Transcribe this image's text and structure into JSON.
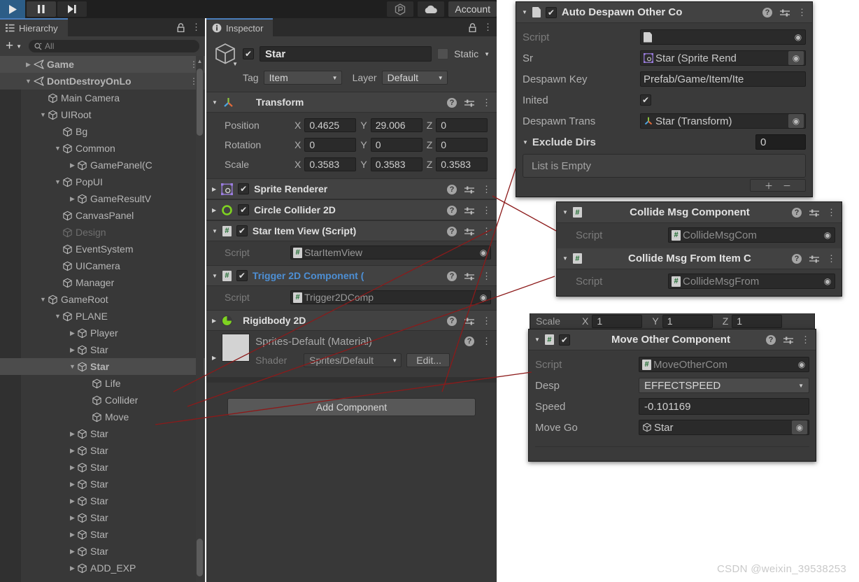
{
  "toolbar": {
    "play_icon": "play-icon",
    "pause_icon": "pause-icon",
    "step_icon": "step-icon",
    "collab_icon": "collab-icon",
    "cloud_icon": "cloud-icon",
    "account_label": "Account"
  },
  "hierarchy": {
    "tab_label": "Hierarchy",
    "lock_icon": "lock-icon",
    "menu_icon": "kebab-menu-icon",
    "create_label": "+",
    "search_placeholder": "All",
    "search_value": "",
    "items": [
      {
        "label": "Game",
        "indent": 0,
        "twisty": "right",
        "icon": "scene-icon",
        "state": "selected-light",
        "dots": true
      },
      {
        "label": "DontDestroyOnLo",
        "indent": 0,
        "twisty": "down",
        "icon": "scene-icon",
        "state": "selected-dark",
        "dots": true
      },
      {
        "label": "Main Camera",
        "indent": 1,
        "twisty": "none",
        "icon": "gameobject-icon",
        "state": "normal",
        "dots": false
      },
      {
        "label": "UIRoot",
        "indent": 1,
        "twisty": "down",
        "icon": "gameobject-icon",
        "state": "normal",
        "dots": false
      },
      {
        "label": "Bg",
        "indent": 2,
        "twisty": "none",
        "icon": "gameobject-icon",
        "state": "normal",
        "dots": false
      },
      {
        "label": "Common",
        "indent": 2,
        "twisty": "down",
        "icon": "gameobject-icon",
        "state": "normal",
        "dots": false
      },
      {
        "label": "GamePanel(C",
        "indent": 3,
        "twisty": "right",
        "icon": "gameobject-icon",
        "state": "normal",
        "dots": false
      },
      {
        "label": "PopUI",
        "indent": 2,
        "twisty": "down",
        "icon": "gameobject-icon",
        "state": "normal",
        "dots": false
      },
      {
        "label": "GameResultV",
        "indent": 3,
        "twisty": "right",
        "icon": "gameobject-icon",
        "state": "normal",
        "dots": false
      },
      {
        "label": "CanvasPanel",
        "indent": 2,
        "twisty": "none",
        "icon": "gameobject-icon",
        "state": "normal",
        "dots": false
      },
      {
        "label": "Design",
        "indent": 2,
        "twisty": "none",
        "icon": "gameobject-icon",
        "state": "disabled",
        "dots": false
      },
      {
        "label": "EventSystem",
        "indent": 2,
        "twisty": "none",
        "icon": "gameobject-icon",
        "state": "normal",
        "dots": false
      },
      {
        "label": "UICamera",
        "indent": 2,
        "twisty": "none",
        "icon": "gameobject-icon",
        "state": "normal",
        "dots": false
      },
      {
        "label": "Manager",
        "indent": 2,
        "twisty": "none",
        "icon": "gameobject-icon",
        "state": "normal",
        "dots": false
      },
      {
        "label": "GameRoot",
        "indent": 1,
        "twisty": "down",
        "icon": "gameobject-icon",
        "state": "normal",
        "dots": false
      },
      {
        "label": "PLANE",
        "indent": 2,
        "twisty": "down",
        "icon": "gameobject-icon",
        "state": "normal",
        "dots": false
      },
      {
        "label": "Player",
        "indent": 3,
        "twisty": "right",
        "icon": "gameobject-icon",
        "state": "normal",
        "dots": false
      },
      {
        "label": "Star",
        "indent": 3,
        "twisty": "right",
        "icon": "gameobject-icon",
        "state": "normal",
        "dots": false
      },
      {
        "label": "Star",
        "indent": 3,
        "twisty": "down",
        "icon": "gameobject-icon",
        "state": "selected-light",
        "dots": false
      },
      {
        "label": "Life",
        "indent": 4,
        "twisty": "none",
        "icon": "gameobject-icon",
        "state": "normal",
        "dots": false
      },
      {
        "label": "Collider",
        "indent": 4,
        "twisty": "none",
        "icon": "gameobject-icon",
        "state": "normal",
        "dots": false
      },
      {
        "label": "Move",
        "indent": 4,
        "twisty": "none",
        "icon": "gameobject-icon",
        "state": "normal",
        "dots": false
      },
      {
        "label": "Star",
        "indent": 3,
        "twisty": "right",
        "icon": "gameobject-icon",
        "state": "normal",
        "dots": false
      },
      {
        "label": "Star",
        "indent": 3,
        "twisty": "right",
        "icon": "gameobject-icon",
        "state": "normal",
        "dots": false
      },
      {
        "label": "Star",
        "indent": 3,
        "twisty": "right",
        "icon": "gameobject-icon",
        "state": "normal",
        "dots": false
      },
      {
        "label": "Star",
        "indent": 3,
        "twisty": "right",
        "icon": "gameobject-icon",
        "state": "normal",
        "dots": false
      },
      {
        "label": "Star",
        "indent": 3,
        "twisty": "right",
        "icon": "gameobject-icon",
        "state": "normal",
        "dots": false
      },
      {
        "label": "Star",
        "indent": 3,
        "twisty": "right",
        "icon": "gameobject-icon",
        "state": "normal",
        "dots": false
      },
      {
        "label": "Star",
        "indent": 3,
        "twisty": "right",
        "icon": "gameobject-icon",
        "state": "normal",
        "dots": false
      },
      {
        "label": "Star",
        "indent": 3,
        "twisty": "right",
        "icon": "gameobject-icon",
        "state": "normal",
        "dots": false
      },
      {
        "label": "ADD_EXP",
        "indent": 3,
        "twisty": "right",
        "icon": "gameobject-icon",
        "state": "normal",
        "dots": false
      }
    ]
  },
  "inspector": {
    "tab_label": "Inspector",
    "lock_icon": "lock-icon",
    "menu_icon": "kebab-menu-icon",
    "object_name": "Star",
    "object_enabled": true,
    "static_label": "Static",
    "static_checked": false,
    "tag_label": "Tag",
    "tag_value": "Item",
    "layer_label": "Layer",
    "layer_value": "Default",
    "transform": {
      "title": "Transform",
      "position_label": "Position",
      "rotation_label": "Rotation",
      "scale_label": "Scale",
      "position": {
        "x": "0.4625",
        "y": "29.006",
        "z": "0"
      },
      "rotation": {
        "x": "0",
        "y": "0",
        "z": "0"
      },
      "scale": {
        "x": "0.3583",
        "y": "0.3583",
        "z": "0.3583"
      }
    },
    "components": [
      {
        "title": "Sprite Renderer",
        "icon": "sprite-renderer-icon",
        "expanded": false,
        "checkbox": true,
        "color": "normal"
      },
      {
        "title": "Circle Collider 2D",
        "icon": "circle-collider-icon",
        "expanded": false,
        "checkbox": true,
        "color": "normal"
      },
      {
        "title": "Star Item View (Script)",
        "icon": "cs-script-icon",
        "expanded": true,
        "checkbox": true,
        "color": "normal",
        "script_label": "Script",
        "script_value": "StarItemView"
      },
      {
        "title": "Trigger 2D Component (",
        "icon": "cs-script-icon",
        "expanded": true,
        "checkbox": true,
        "color": "blue",
        "script_label": "Script",
        "script_value": "Trigger2DComp"
      },
      {
        "title": "Rigidbody 2D",
        "icon": "rigidbody2d-icon",
        "expanded": false,
        "checkbox": false,
        "color": "normal"
      }
    ],
    "material": {
      "title": "Sprites-Default (Material)",
      "shader_label": "Shader",
      "shader_value": "Sprites/Default",
      "edit_label": "Edit..."
    },
    "add_component_label": "Add Component"
  },
  "floating_windows": [
    {
      "id": "despawn",
      "title": "Auto Despawn Other Co",
      "icon": "file-script-icon",
      "checkbox": true,
      "expanded": true,
      "rows": [
        {
          "type": "object",
          "label": "Script",
          "value": "",
          "label_dim": true,
          "icon": "file-script-icon"
        },
        {
          "type": "object",
          "label": "Sr",
          "value": "Star (Sprite Rend",
          "label_dim": false,
          "icon": "sprite-renderer-icon"
        },
        {
          "type": "text",
          "label": "Despawn Key",
          "value": "Prefab/Game/Item/Ite",
          "label_dim": false
        },
        {
          "type": "checkbox",
          "label": "Inited",
          "value": true,
          "label_dim": false
        },
        {
          "type": "object",
          "label": "Despawn Trans",
          "value": "Star (Transform)",
          "label_dim": false,
          "icon": "transform-icon"
        }
      ],
      "foldout": {
        "label": "Exclude Dirs",
        "size": "0",
        "empty_text": "List is Empty"
      }
    },
    {
      "id": "collide",
      "windows": [
        {
          "title": "Collide Msg Component",
          "icon": "cs-script-icon",
          "expanded": true,
          "checkbox": false,
          "rows": [
            {
              "type": "object",
              "label": "Script",
              "value": "CollideMsgCom",
              "label_dim": true,
              "icon": "cs-script-icon"
            }
          ]
        },
        {
          "title": "Collide Msg From Item C",
          "icon": "cs-script-icon",
          "expanded": true,
          "checkbox": false,
          "rows": [
            {
              "type": "object",
              "label": "Script",
              "value": "CollideMsgFrom",
              "label_dim": true,
              "icon": "cs-script-icon"
            }
          ]
        }
      ]
    },
    {
      "id": "move",
      "title": "Move Other Component",
      "icon": "cs-script-icon",
      "checkbox": true,
      "expanded": true,
      "peek_scale": {
        "label": "Scale",
        "x": "1",
        "y": "1",
        "z": "1",
        "ax": "X",
        "ay": "Y",
        "az": "Z"
      },
      "rows": [
        {
          "type": "object",
          "label": "Script",
          "value": "MoveOtherCom",
          "label_dim": true,
          "icon": "cs-script-icon"
        },
        {
          "type": "dropdown",
          "label": "Desp",
          "value": "EFFECTSPEED",
          "label_dim": false
        },
        {
          "type": "number",
          "label": "Speed",
          "value": "-0.101169",
          "label_dim": false
        },
        {
          "type": "object",
          "label": "Move Go",
          "value": "Star",
          "label_dim": false,
          "icon": "gameobject-icon"
        }
      ]
    }
  ],
  "watermark": "CSDN @weixin_39538253",
  "colors": {
    "accent_blue": "#4a7dbb",
    "script_blue": "#4d8fd4",
    "collider_green": "#7fd321",
    "annotation_red": "#8c1a1a",
    "panel_bg": "#393939",
    "header_bg": "#424242"
  }
}
